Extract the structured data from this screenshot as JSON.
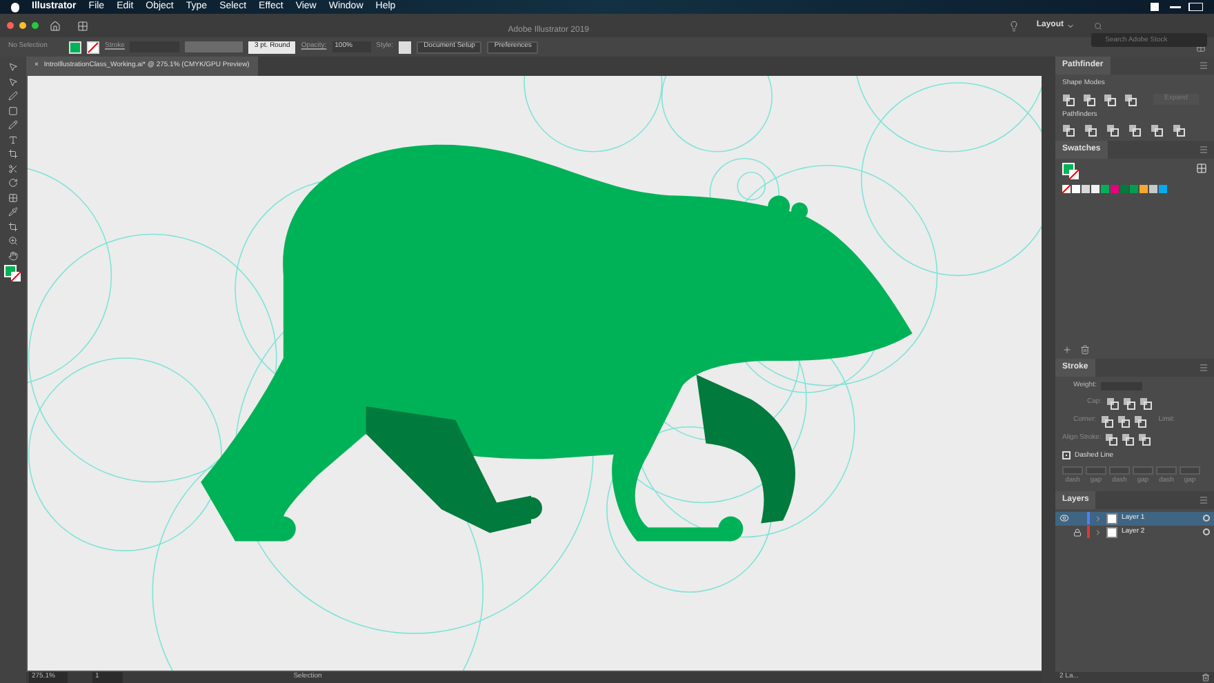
{
  "menu_bar": {
    "app": "Illustrator",
    "items": [
      "File",
      "Edit",
      "Object",
      "Type",
      "Select",
      "Effect",
      "View",
      "Window",
      "Help"
    ]
  },
  "app_bar": {
    "title": "Adobe Illustrator 2019",
    "workspace": "Layout",
    "search": {
      "placeholder": "Search Adobe Stock"
    }
  },
  "control_bar": {
    "selection": "No Selection",
    "stroke_label": "Stroke",
    "brush": "3 pt. Round",
    "opacity_label": "Opacity:",
    "opacity": "100%",
    "style_label": "Style:",
    "buttons": [
      "Document Setup",
      "Preferences"
    ]
  },
  "document_tab": {
    "close": "×",
    "title": "IntroIllustrationClass_Working.ai* @ 275.1% (CMYK/GPU Preview)"
  },
  "pathfinder": {
    "title": "Pathfinder",
    "shape_modes_label": "Shape Modes",
    "expand": "Expand",
    "pathfinders_label": "Pathfinders"
  },
  "swatches": {
    "title": "Swatches",
    "items": [
      {
        "color": "#ffffff"
      },
      {
        "color": "#d9d9d9"
      },
      {
        "color": "#f2f2f2"
      },
      {
        "color": "#00b257"
      },
      {
        "color": "#e6007e"
      },
      {
        "color": "#007a3d"
      },
      {
        "color": "#009e4f"
      },
      {
        "color": "#f7a833"
      },
      {
        "color": "#c8c8c8"
      },
      {
        "color": "#00aeef"
      }
    ]
  },
  "stroke": {
    "title": "Stroke",
    "weight_label": "Weight:",
    "cap_label": "Cap:",
    "corner_label": "Corner:",
    "limit_label": "Limit:",
    "align_label": "Align Stroke:",
    "dashed_line": {
      "label": "Dashed Line",
      "checked": true
    },
    "dash_labels": [
      "dash",
      "gap",
      "dash",
      "gap",
      "dash",
      "gap"
    ]
  },
  "layers": {
    "title": "Layers",
    "items": [
      {
        "name": "Layer 1",
        "color": "#4f7fff",
        "selected": true,
        "visible": true,
        "locked": false
      },
      {
        "name": "Layer 2",
        "color": "#e0353a",
        "selected": false,
        "visible": false,
        "locked": true
      }
    ],
    "count": "2 La..."
  },
  "status_bar": {
    "zoom": "275.1%",
    "artboard": "1",
    "tool": "Selection"
  }
}
